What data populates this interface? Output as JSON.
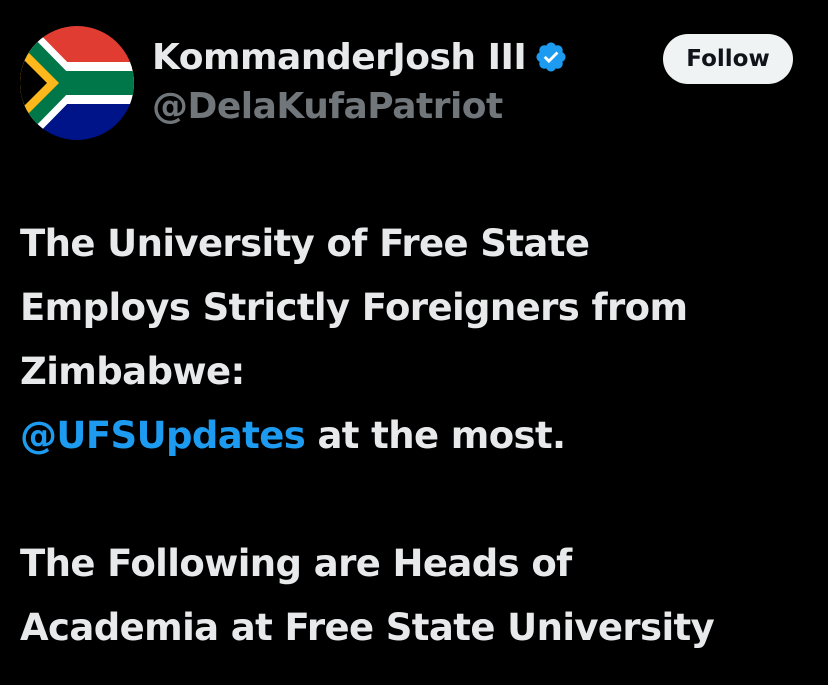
{
  "author": {
    "display_name": "KommanderJosh III",
    "handle": "@DelaKufaPatriot",
    "avatar_icon": "south-africa-flag-icon",
    "verified_icon": "verified-badge-icon"
  },
  "follow_button": {
    "label": "Follow"
  },
  "tweet": {
    "line1": "The University of Free State",
    "line2": "Employs Strictly Foreigners from",
    "line3": "Zimbabwe:",
    "mention": "@UFSUpdates",
    "line4_rest": " at the most.",
    "line5": "The Following are Heads of",
    "line6": "Academia at Free State University"
  },
  "colors": {
    "background": "#000000",
    "text": "#e7e9ea",
    "secondary_text": "#71767b",
    "accent": "#1d9bf0",
    "button_bg": "#eff3f4"
  }
}
